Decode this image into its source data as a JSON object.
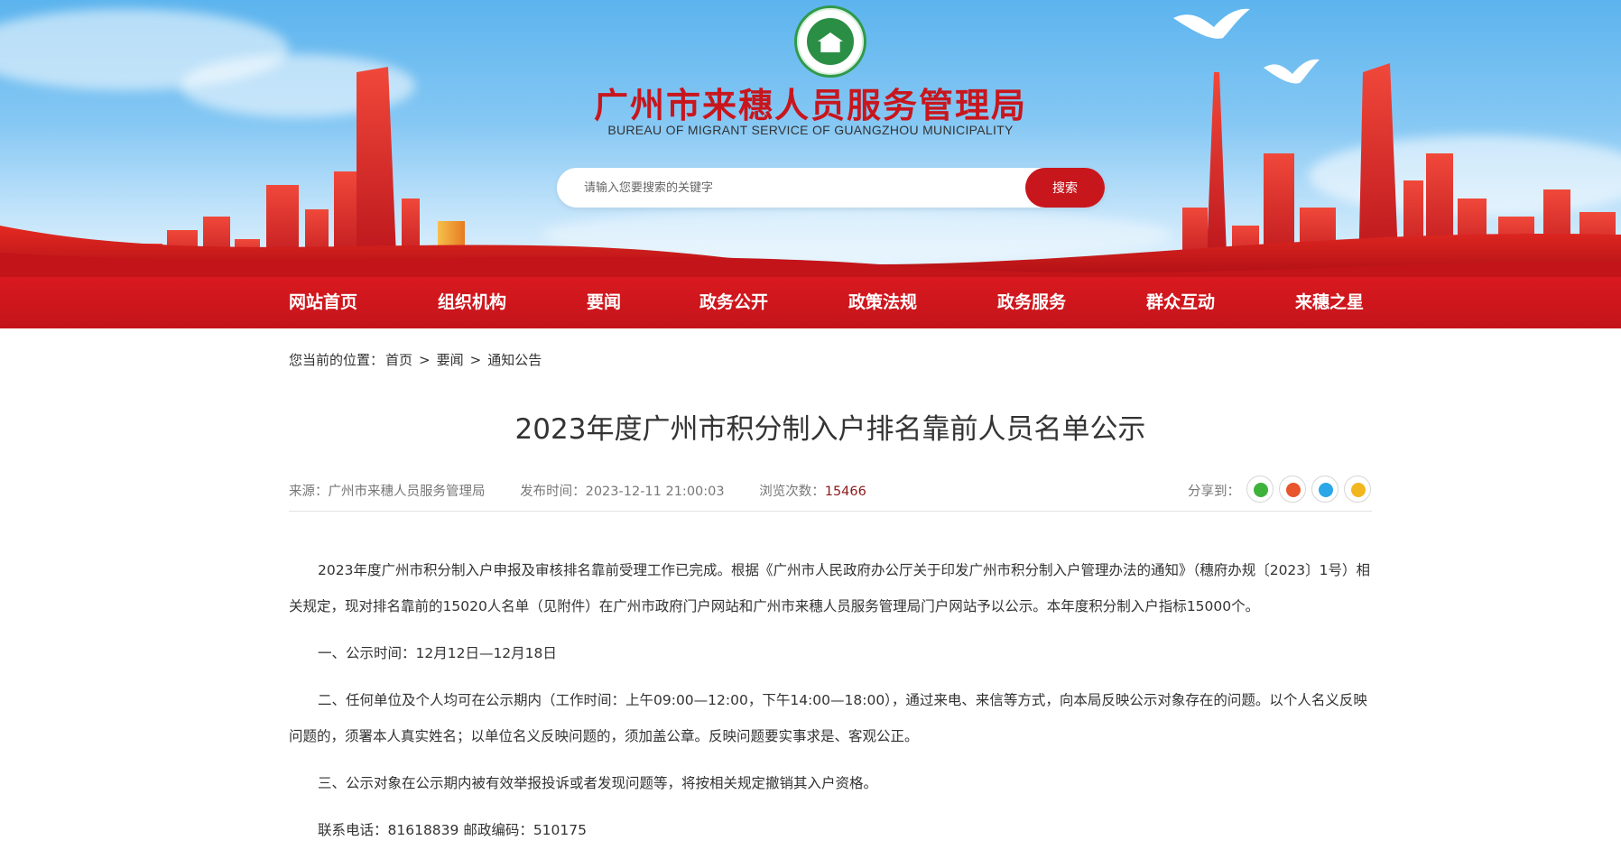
{
  "header": {
    "title": "广州市来穗人员服务管理局",
    "subtitle": "BUREAU OF MIGRANT SERVICE OF GUANGZHOU MUNICIPALITY",
    "search_placeholder": "请输入您要搜索的关键字",
    "search_button": "搜索",
    "colors": {
      "brand_red": "#c8161d",
      "sky_blue": "#6dbcf0",
      "logo_green": "#2a8f45"
    }
  },
  "nav": {
    "items": [
      "网站首页",
      "组织机构",
      "要闻",
      "政务公开",
      "政策法规",
      "政务服务",
      "群众互动",
      "来穗之星"
    ]
  },
  "breadcrumb": {
    "prefix": "您当前的位置：",
    "items": [
      "首页",
      "要闻",
      "通知公告"
    ],
    "separator": ">"
  },
  "article": {
    "title": "2023年度广州市积分制入户排名靠前人员名单公示",
    "meta": {
      "source_label": "来源：",
      "source_value": "广州市来穗人员服务管理局",
      "publish_label": "发布时间：",
      "publish_value": "2023-12-11 21:00:03",
      "views_label": "浏览次数：",
      "views_value": "15466"
    },
    "share_label": "分享到：",
    "share_icons": [
      "wechat-icon",
      "weibo-icon",
      "qq-icon",
      "qzone-icon"
    ],
    "paragraphs": [
      "2023年度广州市积分制入户申报及审核排名靠前受理工作已完成。根据《广州市人民政府办公厅关于印发广州市积分制入户管理办法的通知》（穗府办规〔2023〕1号）相关规定，现对排名靠前的15020人名单（见附件）在广州市政府门户网站和广州市来穗人员服务管理局门户网站予以公示。本年度积分制入户指标15000个。",
      "一、公示时间：12月12日—12月18日",
      "二、任何单位及个人均可在公示期内（工作时间：上午09:00—12:00，下午14:00—18:00），通过来电、来信等方式，向本局反映公示对象存在的问题。以个人名义反映问题的，须署本人真实姓名；以单位名义反映问题的，须加盖公章。反映问题要实事求是、客观公正。",
      "三、公示对象在公示期内被有效举报投诉或者发现问题等，将按相关规定撤销其入户资格。",
      "联系电话：81618839  邮政编码：510175"
    ]
  }
}
